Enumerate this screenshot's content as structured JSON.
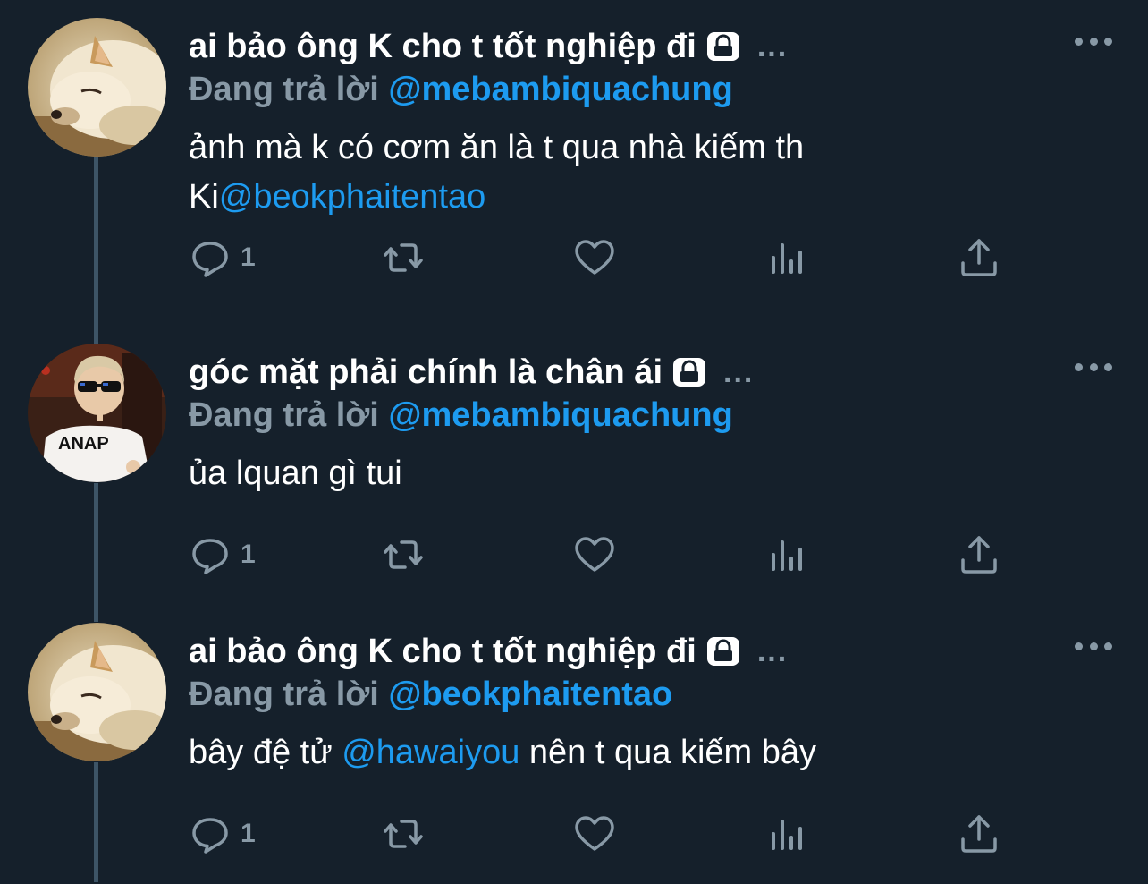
{
  "tweets": [
    {
      "display_name": "ai bảo ông K cho t tốt nghiệp đi",
      "handle_suffix": "...",
      "reply_prefix": "Đang trả lời ",
      "reply_to": "@mebambiquachung",
      "body_line1": "ảnh mà k có cơm ăn là t qua nhà kiếm th",
      "body_line2_text": "Ki",
      "body_line2_mention": "@beokphaitentao",
      "reply_count": "1"
    },
    {
      "display_name": "góc mặt phải chính là chân ái",
      "handle_suffix": "...",
      "reply_prefix": "Đang trả lời ",
      "reply_to": "@mebambiquachung",
      "body_line1": "ủa lquan gì tui",
      "reply_count": "1"
    },
    {
      "display_name": "ai bảo ông K cho t tốt nghiệp đi",
      "handle_suffix": "...",
      "reply_prefix": "Đang trả lời ",
      "reply_to": "@beokphaitentao",
      "body_pre": "bây đệ tử ",
      "body_mention": "@hawaiyou",
      "body_post": " nên t qua kiếm bây",
      "reply_count": "1"
    }
  ],
  "icons": {
    "avatar_1": "dog-avatar",
    "avatar_2": "child-sunglasses-avatar",
    "lock": "lock-icon",
    "more": "more-icon",
    "reply": "reply-icon",
    "retweet": "retweet-icon",
    "like": "heart-icon",
    "analytics": "analytics-icon",
    "share": "share-icon"
  },
  "colors": {
    "background": "#15202b",
    "secondary_text": "#8899a6",
    "mention": "#1d9bf0",
    "thread_line": "#3d5466"
  }
}
